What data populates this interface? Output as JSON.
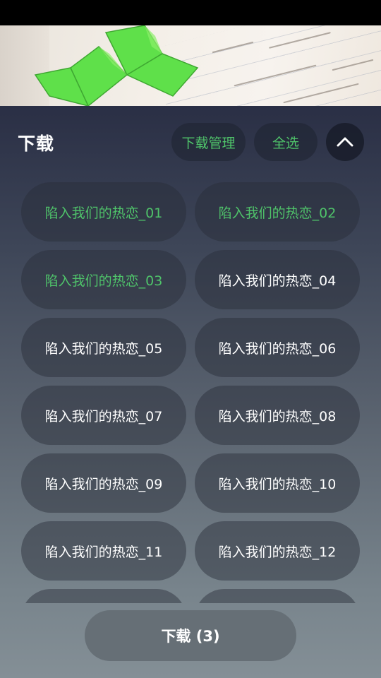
{
  "header": {
    "title": "下载",
    "manage_label": "下载管理",
    "select_all_label": "全选",
    "collapse_icon": "chevron-up-icon"
  },
  "colors": {
    "accent_green": "#4fc36a",
    "sheet_top": "#2a2f45",
    "sheet_bottom": "#848f96"
  },
  "episodes": [
    {
      "label": "陷入我们的热恋_01",
      "selected": true
    },
    {
      "label": "陷入我们的热恋_02",
      "selected": true
    },
    {
      "label": "陷入我们的热恋_03",
      "selected": true
    },
    {
      "label": "陷入我们的热恋_04",
      "selected": false
    },
    {
      "label": "陷入我们的热恋_05",
      "selected": false
    },
    {
      "label": "陷入我们的热恋_06",
      "selected": false
    },
    {
      "label": "陷入我们的热恋_07",
      "selected": false
    },
    {
      "label": "陷入我们的热恋_08",
      "selected": false
    },
    {
      "label": "陷入我们的热恋_09",
      "selected": false
    },
    {
      "label": "陷入我们的热恋_10",
      "selected": false
    },
    {
      "label": "陷入我们的热恋_11",
      "selected": false
    },
    {
      "label": "陷入我们的热恋_12",
      "selected": false
    },
    {
      "label": "",
      "selected": false
    },
    {
      "label": "",
      "selected": false
    }
  ],
  "footer": {
    "download_label": "下载 (3)"
  }
}
